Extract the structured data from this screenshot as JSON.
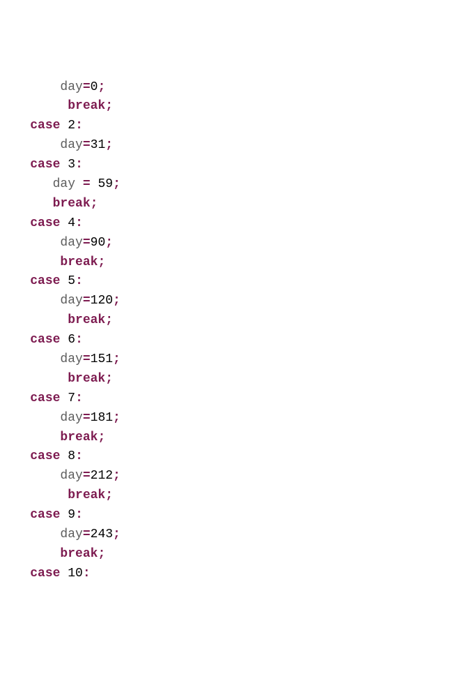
{
  "kw_case": "case",
  "kw_break": "break",
  "id_day": "day",
  "eq": "=",
  "semi": ";",
  "colon": ":",
  "sp": " ",
  "blocks": [
    {
      "indentA": "        ",
      "valA": "0",
      "indentB": "         ",
      "caseNum": "2",
      "caseIndent": "    "
    },
    {
      "indentA": "        ",
      "valA": "31",
      "indentB": null,
      "caseNum": "3",
      "caseIndent": "    ",
      "specialEq": true,
      "specialVal": "59",
      "specialIndentA": "       ",
      "specialIndentB": "       "
    },
    {
      "indentA": "        ",
      "valA": "90",
      "indentB": "        ",
      "caseNum": "5",
      "caseIndent": "    ",
      "prevCase": "4"
    },
    {
      "indentA": "        ",
      "valA": "120",
      "indentB": "         ",
      "caseNum": "6",
      "caseIndent": "    "
    },
    {
      "indentA": "        ",
      "valA": "151",
      "indentB": "         ",
      "caseNum": "7",
      "caseIndent": "    "
    },
    {
      "indentA": "        ",
      "valA": "181",
      "indentB": "        ",
      "caseNum": "8",
      "caseIndent": "    "
    },
    {
      "indentA": "        ",
      "valA": "212",
      "indentB": "         ",
      "caseNum": "9",
      "caseIndent": "    "
    },
    {
      "indentA": "        ",
      "valA": "243",
      "indentB": "        ",
      "caseNum": "10",
      "caseIndent": "    "
    }
  ]
}
